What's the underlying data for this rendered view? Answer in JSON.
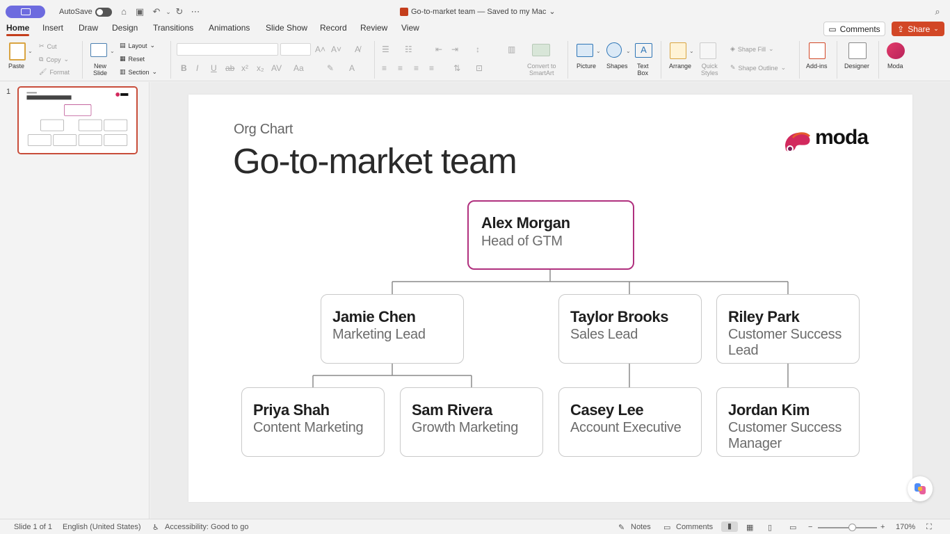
{
  "titlebar": {
    "autosave_label": "AutoSave",
    "doc_title": "Go-to-market team — Saved to my Mac",
    "doc_title_chevron": "⌄"
  },
  "tabs": [
    "Home",
    "Insert",
    "Draw",
    "Design",
    "Transitions",
    "Animations",
    "Slide Show",
    "Record",
    "Review",
    "View"
  ],
  "top_right": {
    "comments": "Comments",
    "share": "Share"
  },
  "ribbon": {
    "paste": "Paste",
    "cut": "Cut",
    "copy": "Copy",
    "format": "Format",
    "new_slide_1": "New",
    "new_slide_2": "Slide",
    "layout": "Layout",
    "reset": "Reset",
    "section": "Section",
    "convert_1": "Convert to",
    "convert_2": "SmartArt",
    "picture": "Picture",
    "shapes": "Shapes",
    "textbox_1": "Text",
    "textbox_2": "Box",
    "arrange": "Arrange",
    "quick_1": "Quick",
    "quick_2": "Styles",
    "shape_fill": "Shape Fill",
    "shape_outline": "Shape Outline",
    "addins": "Add-ins",
    "designer": "Designer",
    "moda": "Moda"
  },
  "thumbnail": {
    "number": "1"
  },
  "slide": {
    "kicker": "Org Chart",
    "title": "Go-to-market team",
    "logo_text": "moda",
    "root": {
      "name": "Alex Morgan",
      "role": "Head of GTM"
    },
    "leads": [
      {
        "name": "Jamie Chen",
        "role": "Marketing Lead"
      },
      {
        "name": "Taylor Brooks",
        "role": "Sales Lead"
      },
      {
        "name": "Riley Park",
        "role": "Customer Success Lead"
      }
    ],
    "members": [
      {
        "name": "Priya Shah",
        "role": "Content Marketing"
      },
      {
        "name": "Sam Rivera",
        "role": "Growth Marketing"
      },
      {
        "name": "Casey Lee",
        "role": "Account Executive"
      },
      {
        "name": "Jordan Kim",
        "role": "Customer Success Manager"
      }
    ]
  },
  "status": {
    "slide_of": "Slide 1 of 1",
    "language": "English (United States)",
    "accessibility": "Accessibility: Good to go",
    "notes": "Notes",
    "comments": "Comments",
    "zoom": "170%"
  },
  "colors": {
    "accent": "#c43e1c",
    "share": "#d24726",
    "root_border": "#b0307e",
    "account_pill": "#6d6bdf"
  }
}
